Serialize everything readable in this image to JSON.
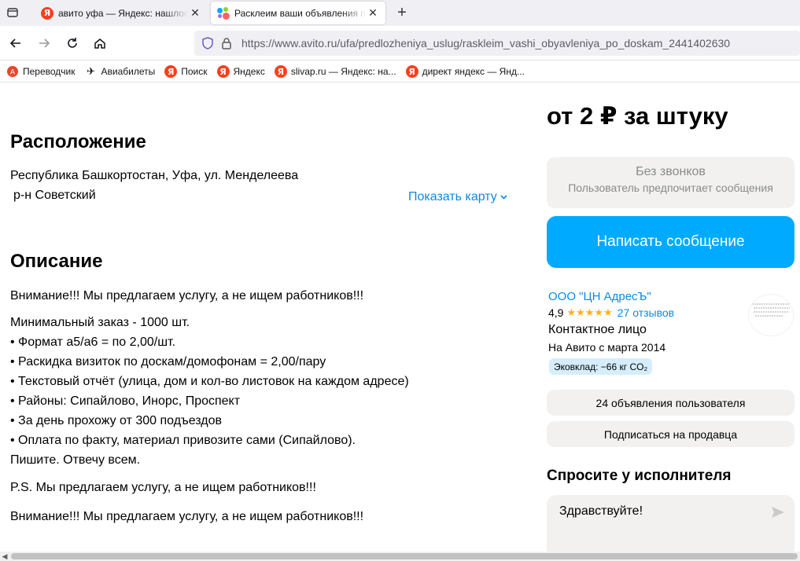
{
  "browser": {
    "tabs": [
      {
        "title": "авито уфа — Яндекс: нашлось",
        "favicon": "yandex-icon",
        "active": false
      },
      {
        "title": "Расклеим ваши объявления по",
        "favicon": "avito-icon",
        "active": true
      }
    ],
    "url": "https://www.avito.ru/ufa/predlozheniya_uslug/raskleim_vashi_obyavleniya_po_doskam_2441402630",
    "bookmarks": [
      {
        "label": "Переводчик",
        "icon": "translate-icon"
      },
      {
        "label": "Авиабилеты",
        "icon": "airplane-icon"
      },
      {
        "label": "Поиск",
        "icon": "yandex-icon"
      },
      {
        "label": "Яндекс",
        "icon": "yandex-icon"
      },
      {
        "label": "slivap.ru — Яндекс: на...",
        "icon": "yandex-icon"
      },
      {
        "label": "директ яндекс — Янд...",
        "icon": "yandex-icon"
      }
    ]
  },
  "location": {
    "heading": "Расположение",
    "address": "Республика Башкортостан, Уфа, ул. Менделеева",
    "district": "р-н Советский",
    "show_map": "Показать карту"
  },
  "description": {
    "heading": "Описание",
    "lines": [
      "Внимание!!! Мы предлагаем услугу, а не ищем работников!!!",
      "Минимальный заказ - 1000 шт.",
      "• Формат а5/а6 = по 2,00/шт.",
      "• Раскидка визиток по доскам/домофонам = 2,00/пару",
      "• Текстовый отчёт (улица, дом и кол-во листовок на каждом адресе)",
      "• Районы: Сипайлово, Инорс, Проспект",
      "• За день прохожу от 300 подъездов",
      "• Оплата по факту, материал привозите сами (Сипайлово).",
      "Пишите. Отвечу всем.",
      "P.S. Мы предлагаем услугу, а не ищем работников!!!",
      "Внимание!!! Мы предлагаем услугу, а не ищем работников!!!"
    ]
  },
  "sidebar": {
    "price": "от 2 ₽ за штуку",
    "no_calls_title": "Без звонков",
    "no_calls_sub": "Пользователь предпочитает сообщения",
    "write_button": "Написать сообщение",
    "seller": {
      "name": "ООО \"ЦН АдресЪ\"",
      "rating": "4,9",
      "stars": "★★★★★",
      "reviews": "27 отзывов",
      "contact": "Контактное лицо",
      "since": "На Авито с марта 2014",
      "eco": "Эковклад: −66 кг CO₂"
    },
    "listings_button": "24 объявления пользователя",
    "subscribe_button": "Подписаться на продавца",
    "ask_title": "Спросите у исполнителя",
    "ask_text": "Здравствуйте!"
  },
  "colors": {
    "accent_blue": "#00aaff",
    "link_blue": "#0a8ae6",
    "star": "#ffb021",
    "yandex_red": "#fc3f1d"
  }
}
